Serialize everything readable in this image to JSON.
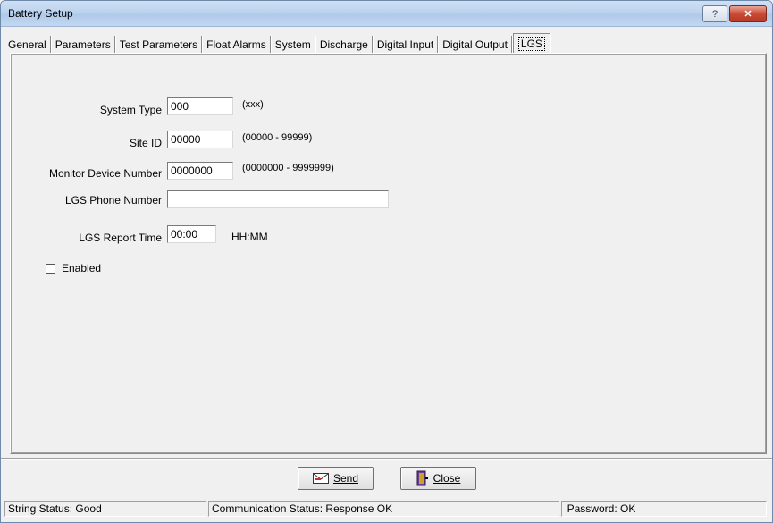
{
  "window": {
    "title": "Battery Setup",
    "help_label": "?",
    "close_label": "✕"
  },
  "tabs": [
    {
      "label": "General",
      "active": false
    },
    {
      "label": "Parameters",
      "active": false
    },
    {
      "label": "Test Parameters",
      "active": false
    },
    {
      "label": "Float Alarms",
      "active": false
    },
    {
      "label": "System",
      "active": false
    },
    {
      "label": "Discharge",
      "active": false
    },
    {
      "label": "Digital Input",
      "active": false
    },
    {
      "label": "Digital Output",
      "active": false
    },
    {
      "label": "LGS",
      "active": true
    }
  ],
  "form": {
    "system_type": {
      "label": "System Type",
      "value": "000",
      "hint": "(xxx)"
    },
    "site_id": {
      "label": "Site ID",
      "value": "00000",
      "hint": "(00000 - 99999)"
    },
    "monitor_device": {
      "label": "Monitor Device Number",
      "value": "0000000",
      "hint": "(0000000 - 9999999)"
    },
    "lgs_phone": {
      "label": "LGS Phone Number",
      "value": ""
    },
    "lgs_report_time": {
      "label": "LGS Report Time",
      "value": "00:00",
      "hint": "HH:MM"
    },
    "enabled": {
      "label": "Enabled",
      "checked": false
    }
  },
  "buttons": {
    "send_label": "Send",
    "close_label": "Close"
  },
  "status_bar": {
    "string_status_label": "String Status:",
    "string_status_value": "Good",
    "comm_status_label": "Communication Status:",
    "comm_status_value": "Response OK",
    "password_label": "Password:",
    "password_value": "OK"
  },
  "colors": {
    "titlebar": "#bcd3ee",
    "close_button": "#c94a35",
    "window_bg": "#f0f0f0"
  }
}
